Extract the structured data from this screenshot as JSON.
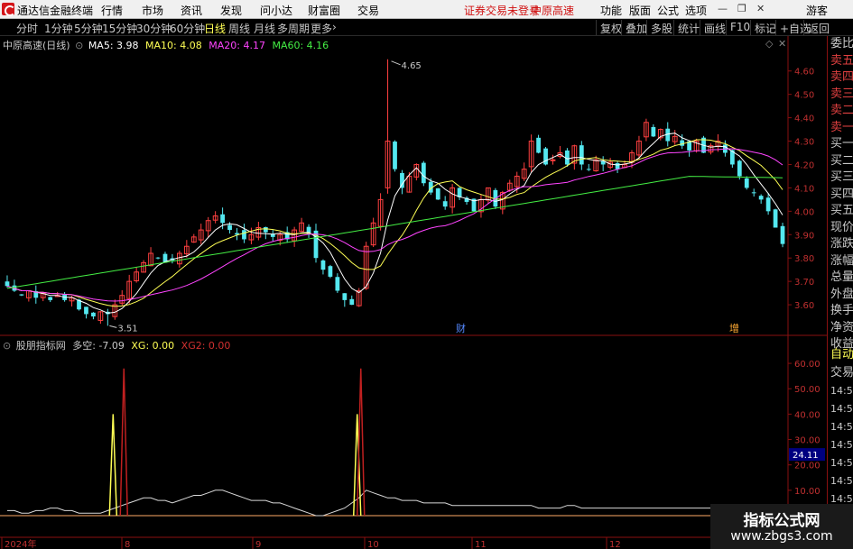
{
  "app": {
    "title": "通达信金融终端",
    "menus": [
      "行情",
      "市场",
      "资讯",
      "发现",
      "问小达",
      "财富圈",
      "交易"
    ],
    "status": "证券交易未登录",
    "stock": "中原高速",
    "right_menus": [
      "功能",
      "版面",
      "公式",
      "选项"
    ],
    "guest": "游客",
    "win_icons": [
      "minimize-icon",
      "restore-icon",
      "close-icon"
    ]
  },
  "toolbar": {
    "periods": [
      "分时",
      "1分钟",
      "5分钟",
      "15分钟",
      "30分钟",
      "60分钟",
      "日线",
      "周线",
      "月线",
      "多周期",
      "更多"
    ],
    "active": "日线",
    "right_buttons": [
      "复权",
      "叠加",
      "多股",
      "统计",
      "画线",
      "F10",
      "标记",
      "+自选",
      "返回"
    ]
  },
  "main": {
    "name": "中原高速(日线)",
    "ma": [
      {
        "label": "MA5: 3.98",
        "color": "#ffffff"
      },
      {
        "label": "MA10: 4.08",
        "color": "#ffff55"
      },
      {
        "label": "MA20: 4.17",
        "color": "#ff44ff"
      },
      {
        "label": "MA60: 4.16",
        "color": "#44ee44"
      }
    ],
    "y_ticks": [
      "4.60",
      "4.50",
      "4.40",
      "4.30",
      "4.20",
      "4.10",
      "4.00",
      "3.90",
      "3.80",
      "3.70",
      "3.60"
    ],
    "high_label": "4.65",
    "low_label": "3.51",
    "markers": [
      "财",
      "增"
    ]
  },
  "sub": {
    "name": "股朋指标网",
    "duokong": "多空: -7.09",
    "xg": "XG: 0.00",
    "xg2": "XG2: 0.00",
    "y_ticks": [
      "60.00",
      "50.00",
      "40.00",
      "30.00",
      "20.00",
      "10.00"
    ],
    "cursor_value": "24.11"
  },
  "x_axis": [
    "2024年",
    "8",
    "9",
    "10",
    "11",
    "12"
  ],
  "sidebar": {
    "items": [
      "委比",
      "卖五",
      "卖四",
      "卖三",
      "卖二",
      "卖一",
      "买一",
      "买二",
      "买三",
      "买四",
      "买五",
      "现价",
      "涨跌",
      "涨幅",
      "总量",
      "外盘",
      "换手",
      "净资",
      "收益"
    ],
    "sub_items": [
      "自动",
      "交易",
      "14:56",
      "14:56",
      "14:56",
      "14:56",
      "14:56",
      "14:56",
      "14:56",
      "14:56",
      "14:56"
    ]
  },
  "watermark": {
    "line1": "指标公式网",
    "line2": "www.zbgs3.com"
  },
  "chart_data": [
    {
      "type": "candlestick",
      "title": "中原高速(日线)",
      "y_range": [
        3.5,
        4.68
      ],
      "series": [
        {
          "name": "MA5",
          "value": 3.98
        },
        {
          "name": "MA10",
          "value": 4.08
        },
        {
          "name": "MA20",
          "value": 4.17
        },
        {
          "name": "MA60",
          "value": 4.16
        }
      ],
      "annotations": [
        {
          "text": "4.65",
          "kind": "high"
        },
        {
          "text": "3.51",
          "kind": "low"
        }
      ],
      "closes": [
        3.68,
        3.66,
        3.64,
        3.66,
        3.63,
        3.65,
        3.62,
        3.64,
        3.62,
        3.63,
        3.58,
        3.56,
        3.55,
        3.57,
        3.56,
        3.6,
        3.64,
        3.7,
        3.74,
        3.78,
        3.82,
        3.8,
        3.78,
        3.79,
        3.82,
        3.85,
        3.89,
        3.92,
        3.96,
        3.98,
        3.95,
        3.92,
        3.9,
        3.88,
        3.9,
        3.93,
        3.91,
        3.89,
        3.9,
        3.88,
        3.92,
        3.95,
        3.9,
        3.8,
        3.75,
        3.72,
        3.66,
        3.62,
        3.6,
        3.66,
        3.85,
        3.95,
        4.05,
        4.3,
        4.18,
        4.1,
        4.15,
        4.2,
        4.12,
        4.08,
        4.05,
        4.02,
        4.1,
        4.06,
        4.04,
        4.0,
        4.05,
        4.1,
        4.02,
        4.08,
        4.12,
        4.15,
        4.18,
        4.3,
        4.25,
        4.2,
        4.22,
        4.25,
        4.2,
        4.28,
        4.2,
        4.18,
        4.22,
        4.2,
        4.21,
        4.18,
        4.2,
        4.25,
        4.3,
        4.38,
        4.32,
        4.35,
        4.3,
        4.32,
        4.28,
        4.26,
        4.3,
        4.25,
        4.28,
        4.3,
        4.25,
        4.2,
        4.15,
        4.1,
        4.08,
        4.05,
        4.0,
        3.93,
        3.86
      ],
      "volume_markers": [
        "财",
        "增"
      ]
    },
    {
      "type": "line",
      "title": "股朋指标网",
      "y_range": [
        0,
        65
      ],
      "series": [
        {
          "name": "多空",
          "value": -7.09,
          "values": [
            2,
            2,
            1,
            1,
            2,
            2,
            3,
            3,
            2,
            2,
            1,
            1,
            1,
            1,
            2,
            3,
            4,
            5,
            6,
            7,
            7,
            6,
            6,
            5,
            6,
            7,
            8,
            8,
            9,
            10,
            10,
            9,
            8,
            7,
            6,
            6,
            6,
            5,
            5,
            4,
            3,
            2,
            1,
            0,
            0,
            1,
            2,
            3,
            5,
            7,
            10,
            9,
            8,
            7,
            7,
            6,
            6,
            6,
            5,
            5,
            5,
            5,
            4,
            4,
            4,
            4,
            4,
            4,
            4,
            4,
            4,
            4,
            4,
            4,
            3,
            3,
            3,
            3,
            4,
            4,
            3,
            3,
            3,
            3,
            3,
            3,
            3,
            3,
            3,
            3,
            3,
            3,
            3,
            3,
            3,
            3,
            3,
            3,
            3,
            3,
            3,
            3,
            3,
            3,
            3,
            3,
            3,
            3,
            3
          ]
        },
        {
          "name": "XG",
          "value": 0.0,
          "spikes": [
            {
              "x_index": 15,
              "value": 40
            },
            {
              "x_index": 49,
              "value": 40
            }
          ]
        },
        {
          "name": "XG2",
          "value": 0.0,
          "spikes": [
            {
              "x_index": 16,
              "value": 58
            },
            {
              "x_index": 49,
              "value": 58
            }
          ]
        }
      ]
    }
  ]
}
